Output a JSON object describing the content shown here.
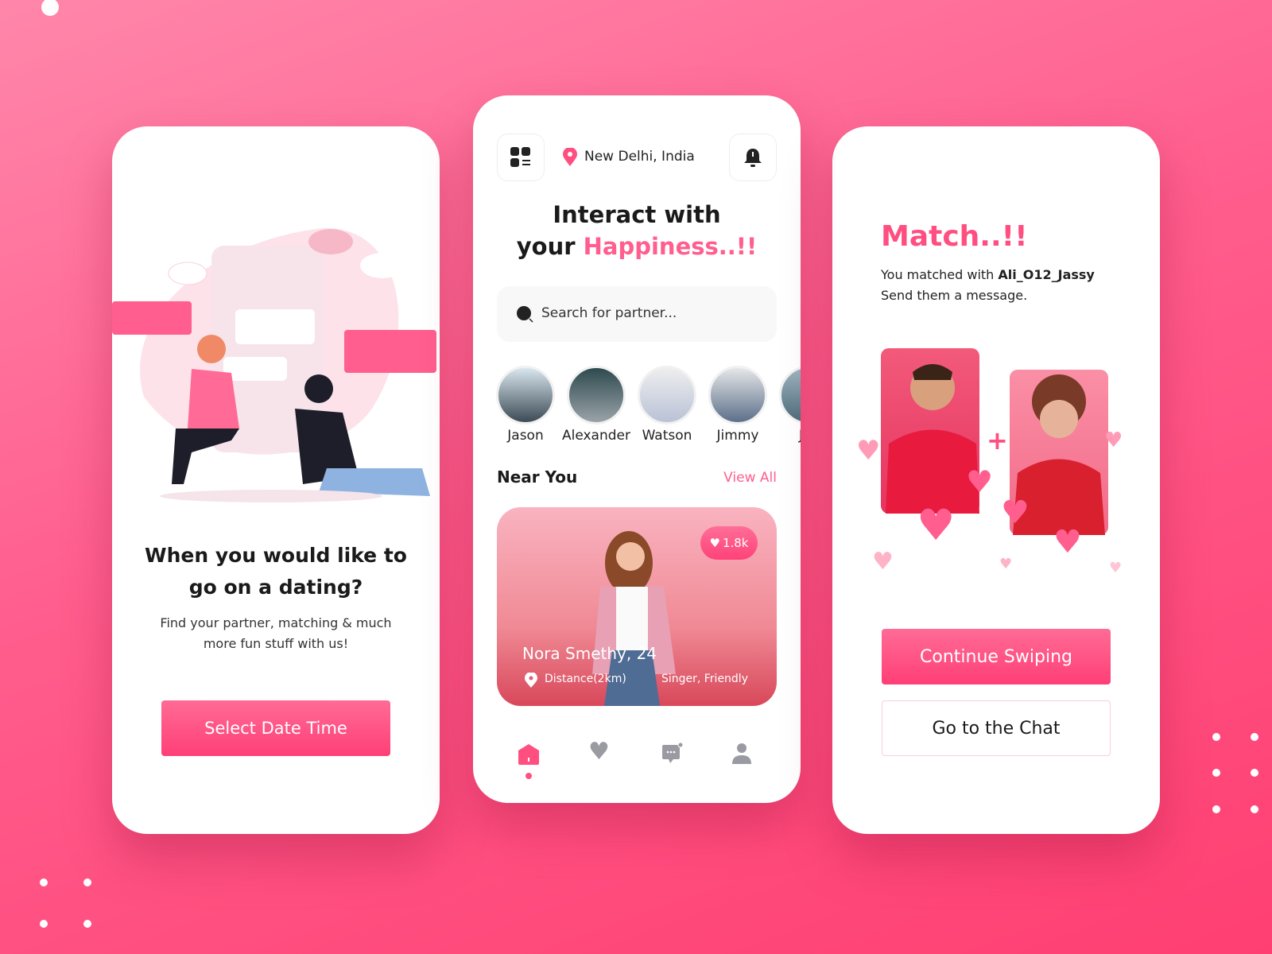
{
  "onboarding": {
    "title": "When you would like to go on a dating?",
    "subtitle": "Find your partner, matching & much more fun stuff with us!",
    "button": "Select Date Time"
  },
  "home": {
    "location": "New Delhi, India",
    "headline_1": "Interact with",
    "headline_2a": "your ",
    "headline_2b": "Happiness..!!",
    "search_placeholder": "Search for partner...",
    "stories": [
      {
        "name": "Jason"
      },
      {
        "name": "Alexander"
      },
      {
        "name": "Watson"
      },
      {
        "name": "Jimmy"
      },
      {
        "name": "Jas"
      }
    ],
    "near_you": "Near You",
    "view_all": "View All",
    "card": {
      "name": "Nora Smethy, 24",
      "distance": "Distance(2km)",
      "tags": "Singer, Friendly",
      "likes": "1.8k"
    },
    "nav": [
      "home-icon",
      "heart-icon",
      "chat-icon",
      "profile-icon"
    ],
    "active_nav": "home"
  },
  "match": {
    "title": "Match..!!",
    "line1_prefix": "You matched with ",
    "user": "Ali_O12_Jassy",
    "line2": "Send them a message.",
    "primary": "Continue Swiping",
    "secondary": "Go to the Chat"
  },
  "colors": {
    "accent": "#ff4f80",
    "text": "#1a1a1a",
    "nav_inactive": "#9a9aa2"
  }
}
